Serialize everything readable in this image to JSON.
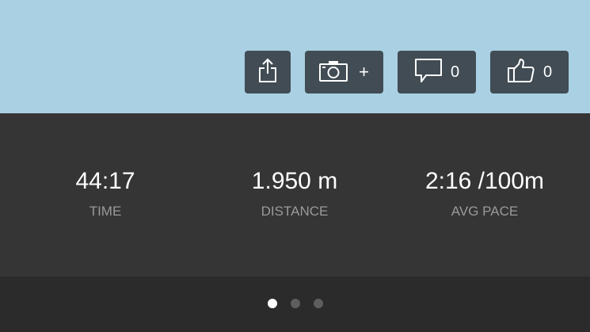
{
  "actions": {
    "share": {
      "icon": "share-icon"
    },
    "photo": {
      "icon": "camera-icon",
      "plus_label": "+"
    },
    "comments": {
      "icon": "comment-icon",
      "count": "0"
    },
    "kudos": {
      "icon": "thumbs-up-icon",
      "count": "0"
    }
  },
  "stats": [
    {
      "value": "44:17",
      "label": "TIME"
    },
    {
      "value": "1.950 m",
      "label": "DISTANCE"
    },
    {
      "value": "2:16 /100m",
      "label": "AVG PACE"
    }
  ],
  "pager": {
    "page_count": 3,
    "active_page": 1
  },
  "colors": {
    "map_background": "#a9d0e3",
    "button_background": "#414c54",
    "stats_background": "#353535",
    "pager_background": "#2b2b2b",
    "label_gray": "#9a9a9a"
  }
}
